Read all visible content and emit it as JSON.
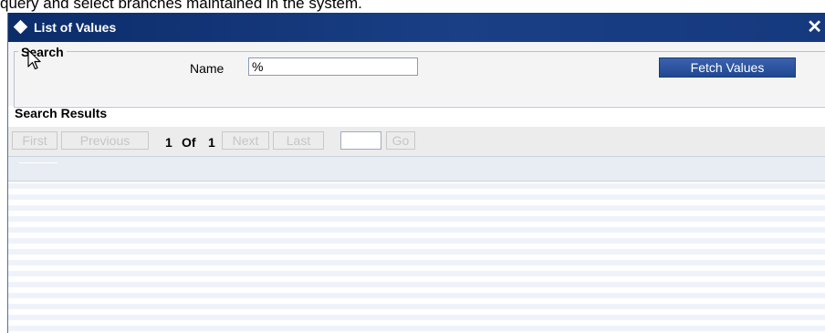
{
  "caption": "query and select branches maintained in the system.",
  "dialog": {
    "title": "List of Values",
    "close_label": "✕"
  },
  "search": {
    "legend": "Search",
    "name_label": "Name",
    "name_value": "%",
    "fetch_label": "Fetch Values"
  },
  "results": {
    "heading": "Search Results"
  },
  "pager": {
    "first_label": "First",
    "previous_label": "Previous",
    "current_page": "1",
    "of_label": "Of",
    "total_pages": "1",
    "next_label": "Next",
    "last_label": "Last",
    "page_input_value": "",
    "go_label": "Go"
  },
  "colors": {
    "titlebar": "#1a3f85",
    "fetch_button": "#2a52a0",
    "disabled_text": "#c6c6c6"
  }
}
